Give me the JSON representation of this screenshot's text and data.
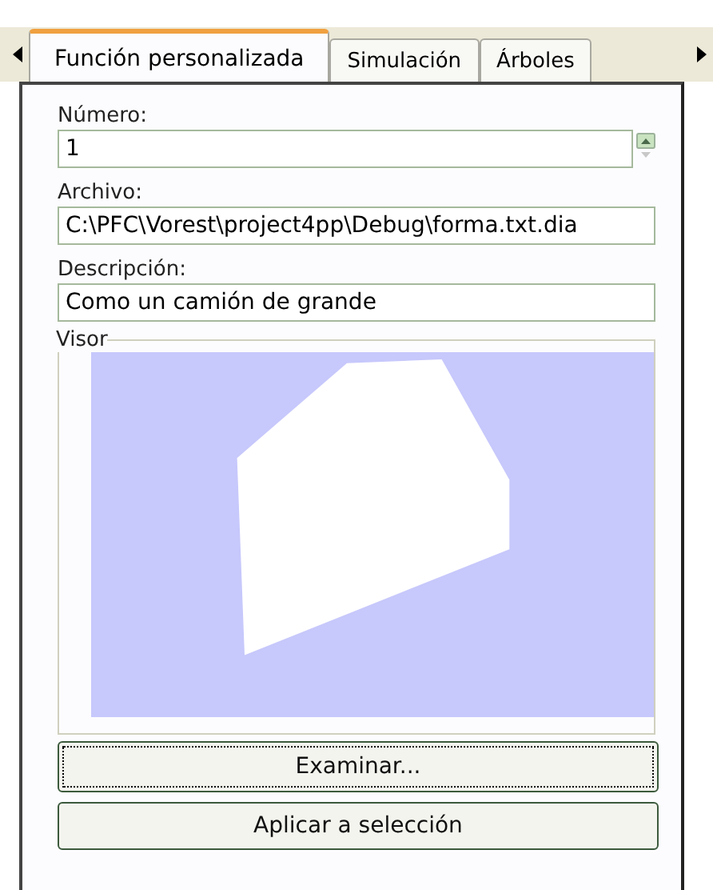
{
  "tabs": [
    {
      "label": "Función personalizada",
      "selected": true
    },
    {
      "label": "Simulación",
      "selected": false
    },
    {
      "label": "Árboles",
      "selected": false
    }
  ],
  "fields": [
    {
      "label": "Número:",
      "value": "1",
      "kind": "spinner"
    },
    {
      "label": "Archivo:",
      "value": "C:\\PFC\\Vorest\\project4pp\\Debug\\forma.txt.dia",
      "kind": "text"
    },
    {
      "label": "Descripción:",
      "value": "Como un camión de grande",
      "kind": "text"
    }
  ],
  "viewer": {
    "title": "Visor"
  },
  "buttons": [
    {
      "label": "Examinar...",
      "focused": true
    },
    {
      "label": "Aplicar a selección",
      "focused": false
    }
  ]
}
